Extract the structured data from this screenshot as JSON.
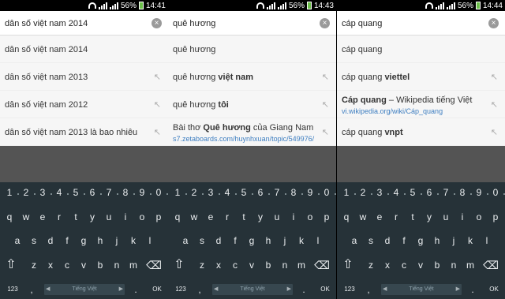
{
  "panels": [
    {
      "status": {
        "battery": "56%",
        "time": "14:41"
      },
      "query": "dân số việt nam 2014",
      "suggestions": [
        {
          "text": "dân số việt nam 2014",
          "arrow": false
        },
        {
          "text": "dân số việt nam 2013",
          "arrow": true
        },
        {
          "text": "dân số việt nam 2012",
          "arrow": true
        },
        {
          "text": "dân số việt nam 2013 là bao nhiêu",
          "arrow": true
        }
      ]
    },
    {
      "status": {
        "battery": "56%",
        "time": "14:43"
      },
      "query": "quê hương",
      "suggestions": [
        {
          "text": "quê hương",
          "arrow": false
        },
        {
          "pre": "quê hương ",
          "bold": "việt nam",
          "arrow": true
        },
        {
          "pre": "quê hương ",
          "bold": "tôi",
          "arrow": true
        },
        {
          "pre": "Bài thơ ",
          "bold": "Quê hương",
          "post": " của Giang Nam",
          "url": "s7.zetaboards.com/huynhxuan/topic/549976/",
          "arrow": true
        }
      ]
    },
    {
      "status": {
        "battery": "56%",
        "time": "14:44"
      },
      "query": "cáp quang",
      "suggestions": [
        {
          "text": "cáp quang",
          "arrow": false
        },
        {
          "pre": "cáp quang ",
          "bold": "viettel",
          "arrow": true
        },
        {
          "bold": "Cáp quang",
          "post": " – Wikipedia tiếng Việt",
          "url": "vi.wikipedia.org/wiki/Cáp_quang",
          "arrow": true
        },
        {
          "pre": "cáp quang ",
          "bold": "vnpt",
          "arrow": true
        }
      ]
    }
  ],
  "keyboard": {
    "numbers": [
      "1",
      "2",
      "3",
      "4",
      "5",
      "6",
      "7",
      "8",
      "9",
      "0"
    ],
    "row1": [
      "q",
      "w",
      "e",
      "r",
      "t",
      "y",
      "u",
      "i",
      "o",
      "p"
    ],
    "row2": [
      "a",
      "s",
      "d",
      "f",
      "g",
      "h",
      "j",
      "k",
      "l"
    ],
    "row3": [
      "z",
      "x",
      "c",
      "v",
      "b",
      "n",
      "m"
    ],
    "mode_label": "123",
    "space_label": "Tiếng Việt",
    "ok_label": "OK"
  }
}
